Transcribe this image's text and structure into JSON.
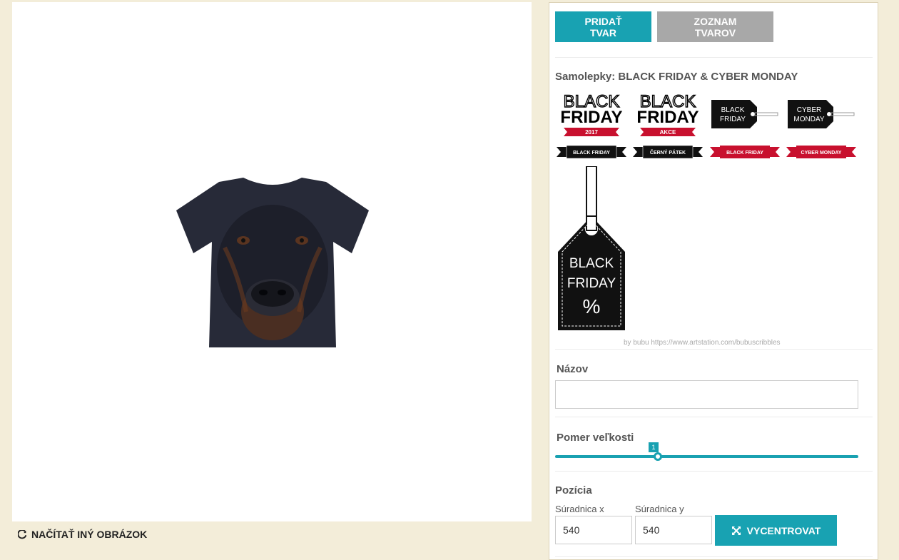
{
  "reload_label": "NAČÍTAŤ INÝ OBRÁZOK",
  "toolbar": {
    "add_shape": "PRIDAŤ TVAR",
    "shape_list": "ZOZNAM TVAROV"
  },
  "stickers": {
    "title": "Samolepky: BLACK FRIDAY & CYBER MONDAY",
    "items": [
      {
        "top": "BLACK",
        "mid": "FRIDAY",
        "ribbon": "2017"
      },
      {
        "top": "BLACK",
        "mid": "FRIDAY",
        "ribbon": "AKCE"
      },
      {
        "line1": "BLACK",
        "line2": "FRIDAY"
      },
      {
        "line1": "CYBER",
        "line2": "MONDAY"
      },
      {
        "ribbon": "BLACK FRIDAY"
      },
      {
        "ribbon": "ČERNÝ PÁTEK"
      },
      {
        "ribbon": "BLACK FRIDAY"
      },
      {
        "ribbon": "CYBER MONDAY"
      },
      {
        "line1": "BLACK",
        "line2": "FRIDAY",
        "line3": "%"
      }
    ],
    "credit": "by bubu https://www.artstation.com/bubuscribbles"
  },
  "name_section": {
    "label": "Názov",
    "value": ""
  },
  "scale_section": {
    "label": "Pomer veľkosti",
    "value": "1"
  },
  "position": {
    "label": "Pozícia",
    "x_label": "Súradnica x",
    "x_value": "540",
    "y_label": "Súradnica y",
    "y_value": "540",
    "center_label": "VYCENTROVAT"
  },
  "colors": {
    "accent": "#18a2b2",
    "secondary": "#a8a8a8",
    "background": "#f3edd9",
    "ribbon_red": "#c8102e"
  }
}
